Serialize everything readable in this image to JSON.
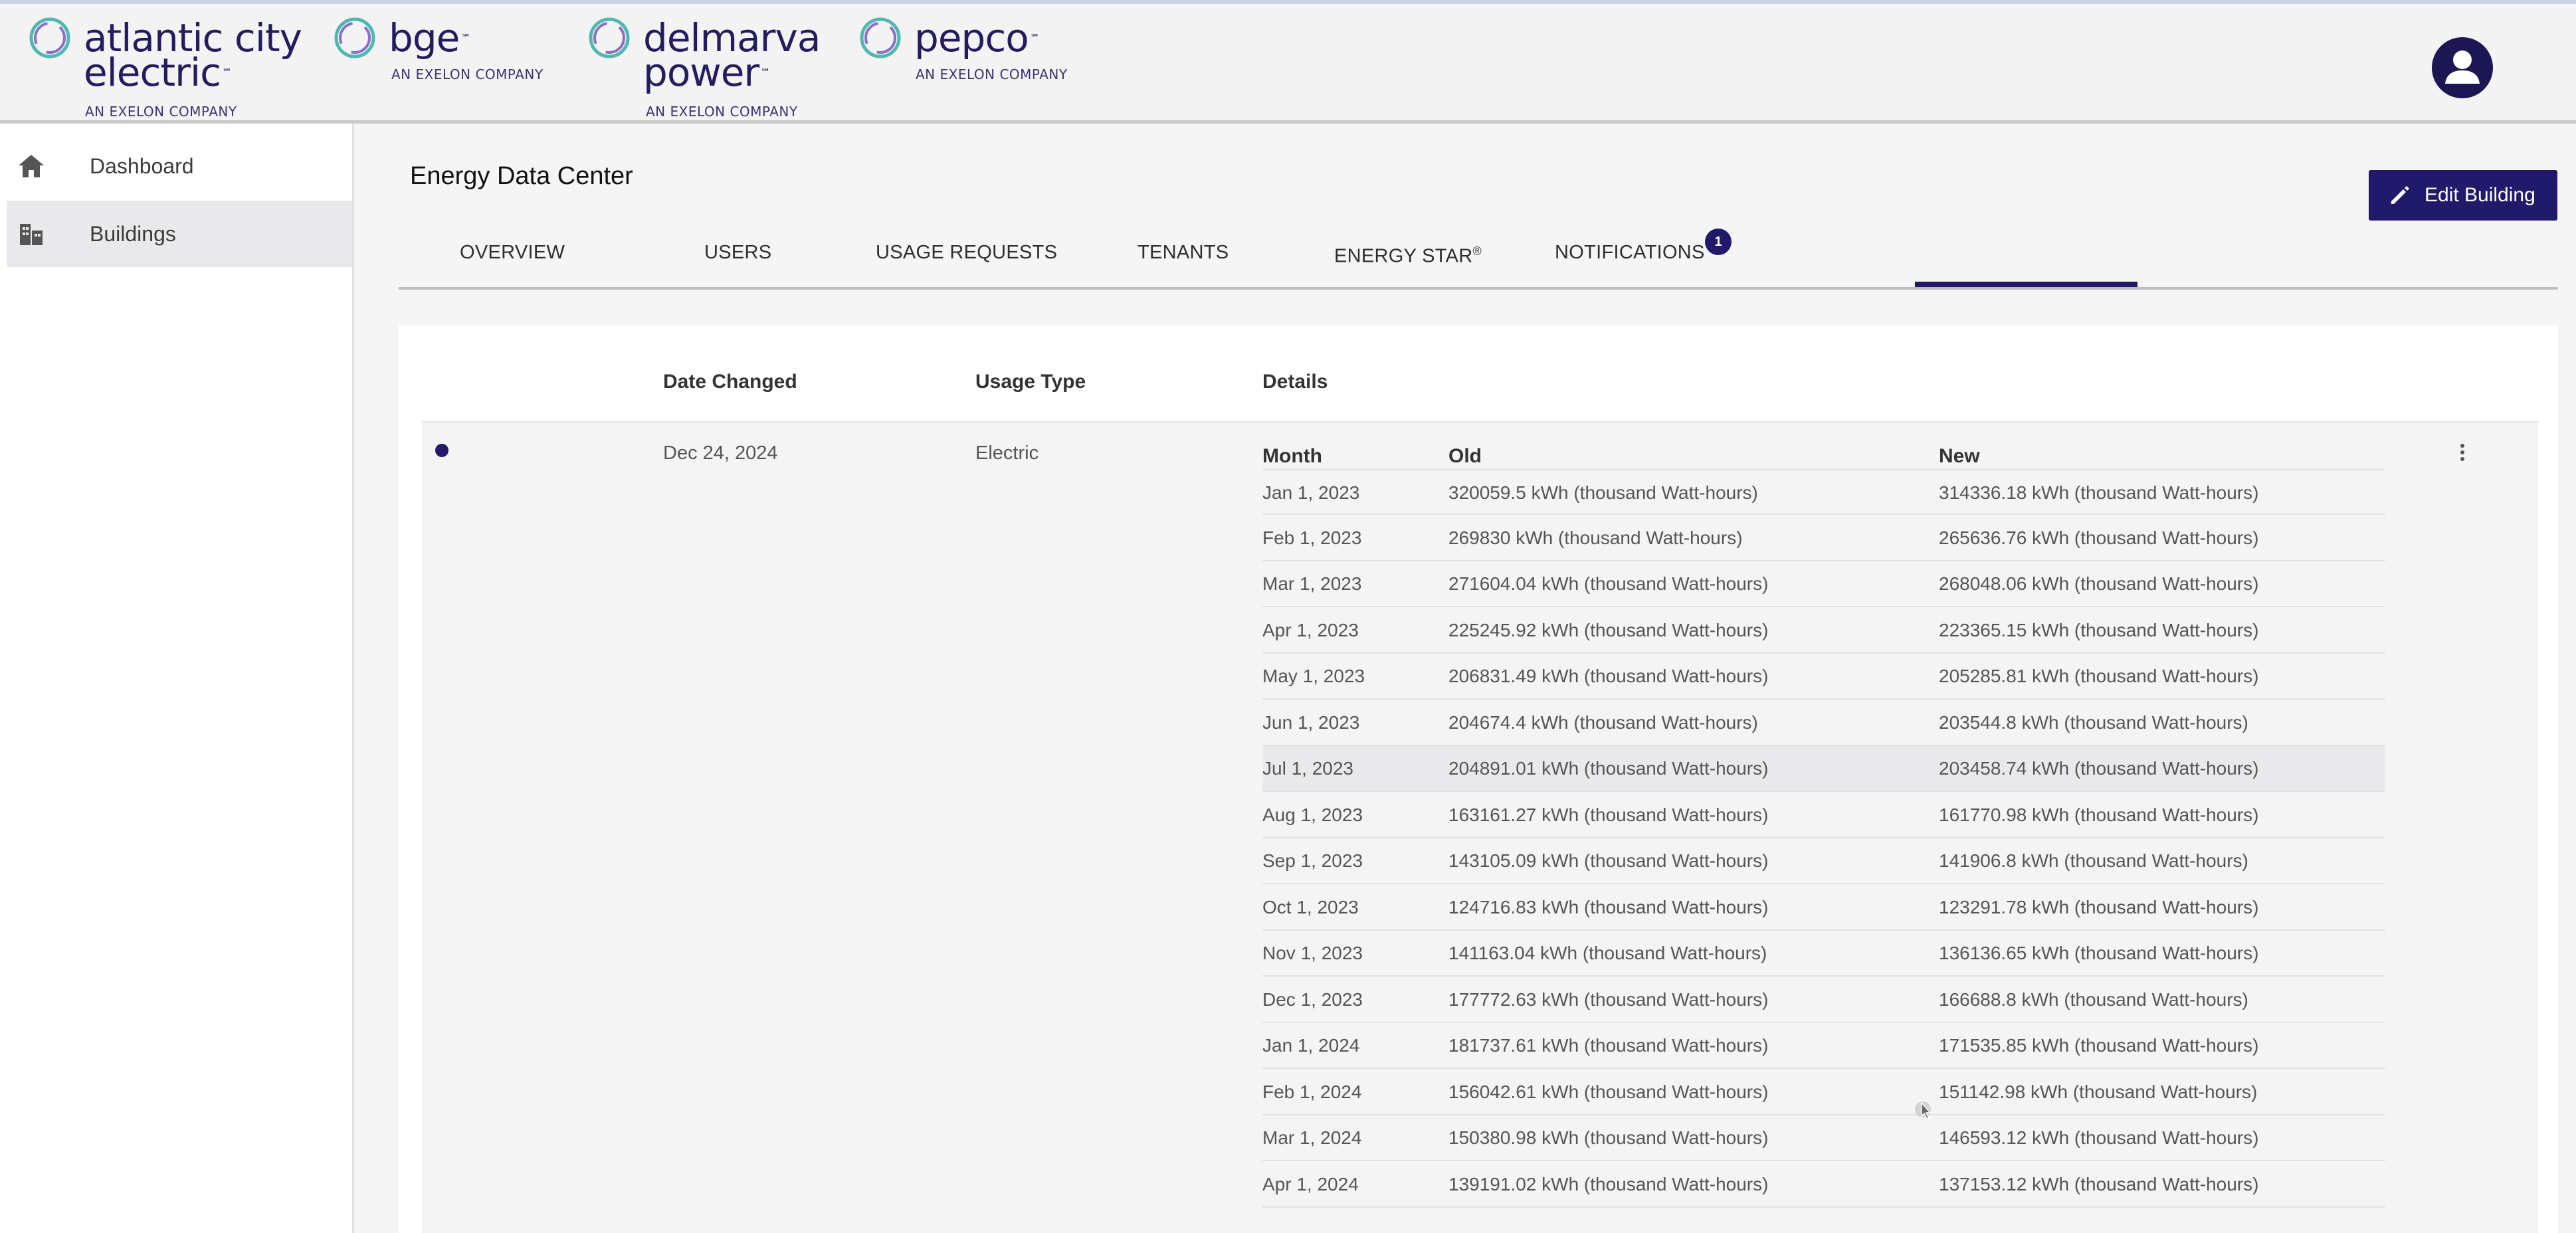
{
  "header": {
    "brands": [
      {
        "name_line1": "atlantic city",
        "name_line2": "electric",
        "sub": "AN EXELON COMPANY"
      },
      {
        "name_line1": "bge",
        "sub": "AN EXELON COMPANY"
      },
      {
        "name_line1": "delmarva",
        "name_line2": "power",
        "sub": "AN EXELON COMPANY"
      },
      {
        "name_line1": "pepco",
        "sub": "AN EXELON COMPANY"
      }
    ],
    "tm": "℠",
    "avatar_icon": "user-icon"
  },
  "sidebar": {
    "items": [
      {
        "label": "Dashboard",
        "icon": "home-icon",
        "active": false
      },
      {
        "label": "Buildings",
        "icon": "building-icon",
        "active": true
      }
    ]
  },
  "main": {
    "title": "Energy Data Center",
    "edit_button": "Edit Building",
    "tabs": [
      {
        "label": "OVERVIEW"
      },
      {
        "label": "USERS"
      },
      {
        "label": "USAGE REQUESTS"
      },
      {
        "label": "TENANTS"
      },
      {
        "label": "ENERGY STAR",
        "sup": "®"
      },
      {
        "label": "NOTIFICATIONS",
        "active": true
      }
    ],
    "notifications_badge": "1"
  },
  "table": {
    "headers": {
      "date": "Date Changed",
      "usage_type": "Usage Type",
      "details": "Details"
    },
    "row": {
      "date": "Dec 24, 2024",
      "usage_type": "Electric",
      "details_headers": {
        "month": "Month",
        "old": "Old",
        "new": "New"
      },
      "details": [
        {
          "month": "Jan 1, 2023",
          "old": "320059.5 kWh (thousand Watt-hours)",
          "new": "314336.18 kWh (thousand Watt-hours)"
        },
        {
          "month": "Feb 1, 2023",
          "old": "269830 kWh (thousand Watt-hours)",
          "new": "265636.76 kWh (thousand Watt-hours)"
        },
        {
          "month": "Mar 1, 2023",
          "old": "271604.04 kWh (thousand Watt-hours)",
          "new": "268048.06 kWh (thousand Watt-hours)"
        },
        {
          "month": "Apr 1, 2023",
          "old": "225245.92 kWh (thousand Watt-hours)",
          "new": "223365.15 kWh (thousand Watt-hours)"
        },
        {
          "month": "May 1, 2023",
          "old": "206831.49 kWh (thousand Watt-hours)",
          "new": "205285.81 kWh (thousand Watt-hours)"
        },
        {
          "month": "Jun 1, 2023",
          "old": "204674.4 kWh (thousand Watt-hours)",
          "new": "203544.8 kWh (thousand Watt-hours)"
        },
        {
          "month": "Jul 1, 2023",
          "old": "204891.01 kWh (thousand Watt-hours)",
          "new": "203458.74 kWh (thousand Watt-hours)"
        },
        {
          "month": "Aug 1, 2023",
          "old": "163161.27 kWh (thousand Watt-hours)",
          "new": "161770.98 kWh (thousand Watt-hours)"
        },
        {
          "month": "Sep 1, 2023",
          "old": "143105.09 kWh (thousand Watt-hours)",
          "new": "141906.8 kWh (thousand Watt-hours)"
        },
        {
          "month": "Oct 1, 2023",
          "old": "124716.83 kWh (thousand Watt-hours)",
          "new": "123291.78 kWh (thousand Watt-hours)"
        },
        {
          "month": "Nov 1, 2023",
          "old": "141163.04 kWh (thousand Watt-hours)",
          "new": "136136.65 kWh (thousand Watt-hours)"
        },
        {
          "month": "Dec 1, 2023",
          "old": "177772.63 kWh (thousand Watt-hours)",
          "new": "166688.8 kWh (thousand Watt-hours)"
        },
        {
          "month": "Jan 1, 2024",
          "old": "181737.61 kWh (thousand Watt-hours)",
          "new": "171535.85 kWh (thousand Watt-hours)"
        },
        {
          "month": "Feb 1, 2024",
          "old": "156042.61 kWh (thousand Watt-hours)",
          "new": "151142.98 kWh (thousand Watt-hours)"
        },
        {
          "month": "Mar 1, 2024",
          "old": "150380.98 kWh (thousand Watt-hours)",
          "new": "146593.12 kWh (thousand Watt-hours)"
        },
        {
          "month": "Apr 1, 2024",
          "old": "139191.02 kWh (thousand Watt-hours)",
          "new": "137153.12 kWh (thousand Watt-hours)"
        }
      ]
    }
  },
  "colors": {
    "brand_navy": "#211a6b",
    "logo_teal": "#4fb9ad",
    "logo_purple": "#8a6fc9"
  }
}
